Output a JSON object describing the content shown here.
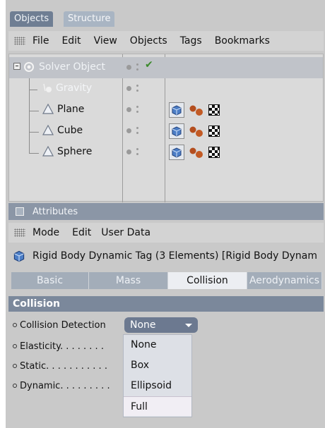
{
  "tabs": [
    {
      "label": "Objects",
      "active": true
    },
    {
      "label": "Structure",
      "active": false
    }
  ],
  "menu": [
    "File",
    "Edit",
    "View",
    "Objects",
    "Tags",
    "Bookmarks"
  ],
  "objects": [
    {
      "name": "Solver Object",
      "icon": "solver-icon",
      "tags": false,
      "check": true
    },
    {
      "name": "Gravity",
      "icon": "gravity-icon",
      "tags": false,
      "check": false
    },
    {
      "name": "Plane",
      "icon": "cone-icon",
      "tags": true,
      "check": false
    },
    {
      "name": "Cube",
      "icon": "cone-icon",
      "tags": true,
      "check": false
    },
    {
      "name": "Sphere",
      "icon": "cone-icon",
      "tags": true,
      "check": false
    }
  ],
  "attributes": {
    "title": "Attributes",
    "menu": [
      "Mode",
      "Edit",
      "User Data"
    ],
    "tag_title": "Rigid Body Dynamic Tag (3 Elements) [Rigid Body Dynam",
    "subtabs": [
      {
        "label": "Basic",
        "active": false
      },
      {
        "label": "Mass",
        "active": false
      },
      {
        "label": "Collision",
        "active": true
      },
      {
        "label": "Aerodynamics",
        "active": false
      }
    ],
    "section": "Collision",
    "properties": [
      {
        "label": "Collision Detection"
      },
      {
        "label": "Elasticity. . . . . . . ."
      },
      {
        "label": "Static. . . . . . . . . . ."
      },
      {
        "label": "Dynamic. . . . . . . . ."
      }
    ],
    "dropdown": {
      "value": "None",
      "options": [
        "None",
        "Box",
        "Ellipsoid",
        "Full"
      ],
      "highlighted": "Full"
    }
  },
  "colors": {
    "panel": "#c9c9c9",
    "active_tab": "#6f7e93",
    "section": "#7b889b",
    "dropdown": "#6c7990"
  }
}
